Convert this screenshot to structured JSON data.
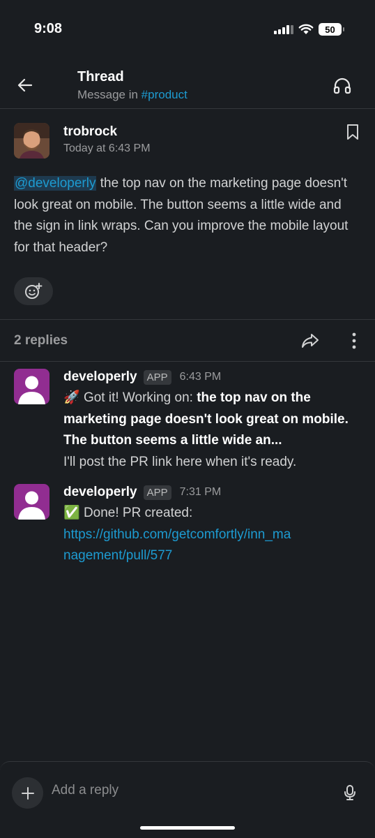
{
  "status_bar": {
    "time": "9:08",
    "battery": "50"
  },
  "header": {
    "title": "Thread",
    "subtitle_prefix": "Message in ",
    "channel": "#product"
  },
  "parent_message": {
    "author": "trobrock",
    "timestamp": "Today at 6:43 PM",
    "mention": "@developerly",
    "text": " the top nav on the marketing page doesn't look great on mobile. The button seems a little wide and the sign in link wraps. Can you improve the mobile layout for that header?"
  },
  "replies_label": "2 replies",
  "replies": [
    {
      "author": "developerly",
      "badge": "APP",
      "time": "6:43 PM",
      "emoji": "🚀",
      "prefix": " Got it! Working on: ",
      "bold": "the top nav on the marketing page doesn't look great on mobile. The button seems a little wide an...",
      "line2": "I'll post the PR link here when it's ready."
    },
    {
      "author": "developerly",
      "badge": "APP",
      "time": "7:31 PM",
      "emoji": "✅",
      "prefix": " Done! PR created:",
      "link": "https://github.com/getcomfortly/inn_management/pull/577"
    }
  ],
  "composer": {
    "placeholder": "Add a reply"
  },
  "colors": {
    "background": "#1a1d21",
    "link": "#1d9bd1",
    "bot_avatar": "#912d91"
  },
  "icons": [
    "back-arrow-icon",
    "headphones-icon",
    "bookmark-icon",
    "add-reaction-icon",
    "share-icon",
    "more-vertical-icon",
    "plus-icon",
    "microphone-icon"
  ]
}
